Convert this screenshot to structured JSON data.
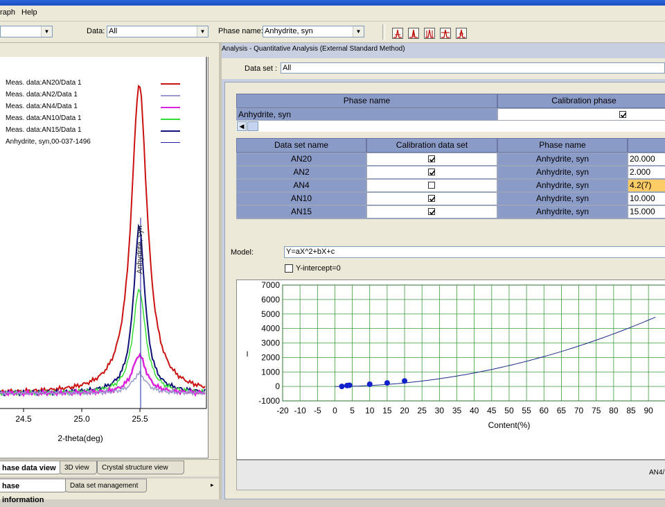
{
  "menu": {
    "items": [
      "raph",
      "Help"
    ]
  },
  "toolbar": {
    "data_label": "Data:",
    "data_value": "All",
    "phase_label": "Phase name:",
    "phase_value": "Anhydrite, syn",
    "left_combo_value": ""
  },
  "left_plot": {
    "legend": [
      {
        "label": "Meas. data:AN20/Data 1",
        "color": "#cc1111"
      },
      {
        "label": "Meas. data:AN2/Data 1",
        "color": "#9999cc"
      },
      {
        "label": "Meas. data:AN4/Data 1",
        "color": "#dd22dd"
      },
      {
        "label": "Meas. data:AN10/Data 1",
        "color": "#33dd33"
      },
      {
        "label": "Meas. data:AN15/Data 1",
        "color": "#111177"
      },
      {
        "label": "Anhydrite, syn,00-037-1496",
        "color": "#2222aa"
      }
    ],
    "peak_label": "Anhydrite, syn",
    "x_ticks": [
      "24.5",
      "25.0",
      "25.5"
    ],
    "xlabel": "2-theta(deg)"
  },
  "tabs_row1": [
    "hase data view",
    "3D view",
    "Crystal structure view"
  ],
  "tabs_row2": [
    "hase information",
    "Data set management"
  ],
  "analysis": {
    "title": "Analysis - Quantitative Analysis (External Standard Method)",
    "dataset_label": "Data set :",
    "dataset_value": "All",
    "phase_table": {
      "headers": [
        "Phase name",
        "Calibration phase"
      ],
      "rows": [
        {
          "name": "Anhydrite, syn",
          "checked": true
        }
      ]
    },
    "data_table": {
      "headers": [
        "Data set name",
        "Calibration data set",
        "Phase name",
        ""
      ],
      "rows": [
        {
          "name": "AN20",
          "checked": true,
          "phase": "Anhydrite, syn",
          "value": "20.000"
        },
        {
          "name": "AN2",
          "checked": true,
          "phase": "Anhydrite, syn",
          "value": "2.000"
        },
        {
          "name": "AN4",
          "checked": false,
          "phase": "Anhydrite, syn",
          "value": "4.2(7)"
        },
        {
          "name": "AN10",
          "checked": true,
          "phase": "Anhydrite, syn",
          "value": "10.000"
        },
        {
          "name": "AN15",
          "checked": true,
          "phase": "Anhydrite, syn",
          "value": "15.000"
        }
      ]
    },
    "model_label": "Model:",
    "model_value": "Y=aX^2+bX+c",
    "yintercept_label": "Y-intercept=0",
    "yintercept_checked": false,
    "footer_text": "AN4/"
  },
  "chart_data": {
    "type": "scatter",
    "xlabel": "Content(%)",
    "ylabel": "I",
    "xlim": [
      -20,
      90
    ],
    "ylim": [
      -1000,
      7000
    ],
    "x_ticks": [
      -20,
      -10,
      -5,
      0,
      5,
      10,
      15,
      20,
      25,
      30,
      35,
      40,
      45,
      50,
      55,
      60,
      65,
      70,
      75,
      80,
      85,
      90
    ],
    "y_ticks": [
      -1000,
      0,
      1000,
      2000,
      3000,
      4000,
      5000,
      6000,
      7000
    ],
    "grid": true,
    "points": [
      {
        "x": 2,
        "y": 0
      },
      {
        "x": 3.5,
        "y": 60
      },
      {
        "x": 4.2,
        "y": 80
      },
      {
        "x": 10,
        "y": 150
      },
      {
        "x": 15,
        "y": 240
      },
      {
        "x": 20,
        "y": 380
      }
    ],
    "fit_curve": {
      "model": "Y=aX^2+bX+c",
      "a": 0.55,
      "b": 1.5,
      "c": -10
    }
  }
}
